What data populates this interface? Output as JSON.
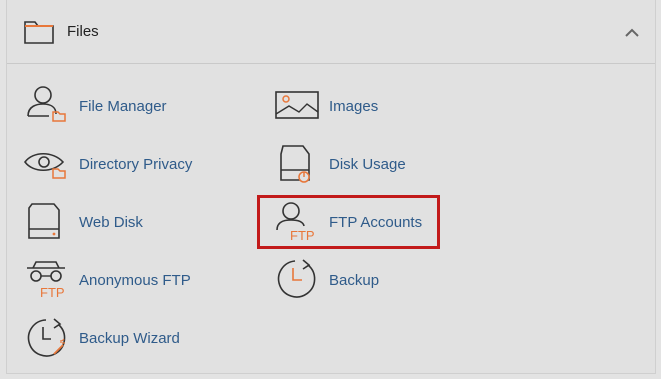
{
  "panel": {
    "title": "Files",
    "accent_color": "#e8773a",
    "highlight_color": "#c21a1a",
    "items": [
      {
        "label": "File Manager",
        "icon": "file-manager-icon"
      },
      {
        "label": "Images",
        "icon": "images-icon"
      },
      {
        "label": "Directory Privacy",
        "icon": "directory-privacy-icon"
      },
      {
        "label": "Disk Usage",
        "icon": "disk-usage-icon"
      },
      {
        "label": "Web Disk",
        "icon": "web-disk-icon"
      },
      {
        "label": "FTP Accounts",
        "icon": "ftp-accounts-icon",
        "highlighted": true
      },
      {
        "label": "Anonymous FTP",
        "icon": "anonymous-ftp-icon"
      },
      {
        "label": "Backup",
        "icon": "backup-icon"
      },
      {
        "label": "Backup Wizard",
        "icon": "backup-wizard-icon"
      }
    ],
    "ftp_badge": "FTP"
  }
}
